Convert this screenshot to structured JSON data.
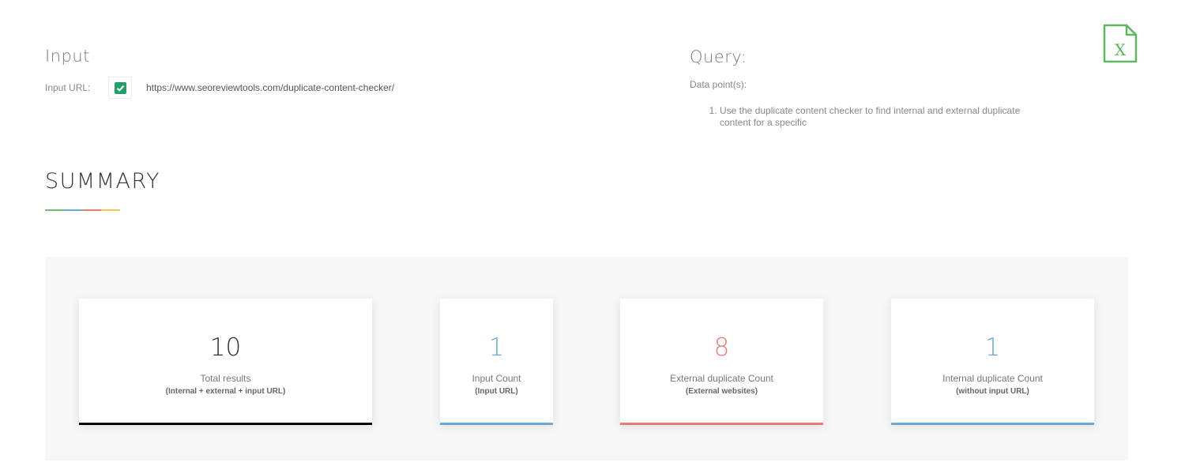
{
  "input": {
    "title": "Input",
    "url_label": "Input URL:",
    "url_value": "https://www.seoreviewtools.com/duplicate-content-checker/",
    "checked": true
  },
  "query": {
    "title": "Query:",
    "data_points_label": "Data point(s):",
    "items": [
      "Use the duplicate content checker to find internal and external duplicate content for a specific"
    ]
  },
  "export": {
    "icon": "excel-export-icon",
    "color": "#4caf50"
  },
  "summary": {
    "title": "SUMMARY",
    "underline_colors": [
      "#6fbf73",
      "#6aa9d8",
      "#f07a6e",
      "#f2c45a"
    ],
    "cards": [
      {
        "value": "10",
        "label": "Total results",
        "sub": "(Internal + external + input URL)",
        "value_color": "#333333",
        "bar_color": "#000000"
      },
      {
        "value": "1",
        "label": "Input Count",
        "sub": "(Input URL)",
        "value_color": "#6aa9d8",
        "bar_color": "#6aa9d8"
      },
      {
        "value": "8",
        "label": "External duplicate Count",
        "sub": "(External websites)",
        "value_color": "#ee7b6f",
        "bar_color": "#ee7b6f"
      },
      {
        "value": "1",
        "label": "Internal duplicate Count",
        "sub": "(without input URL)",
        "value_color": "#6aa9d8",
        "bar_color": "#6aa9d8"
      }
    ]
  }
}
